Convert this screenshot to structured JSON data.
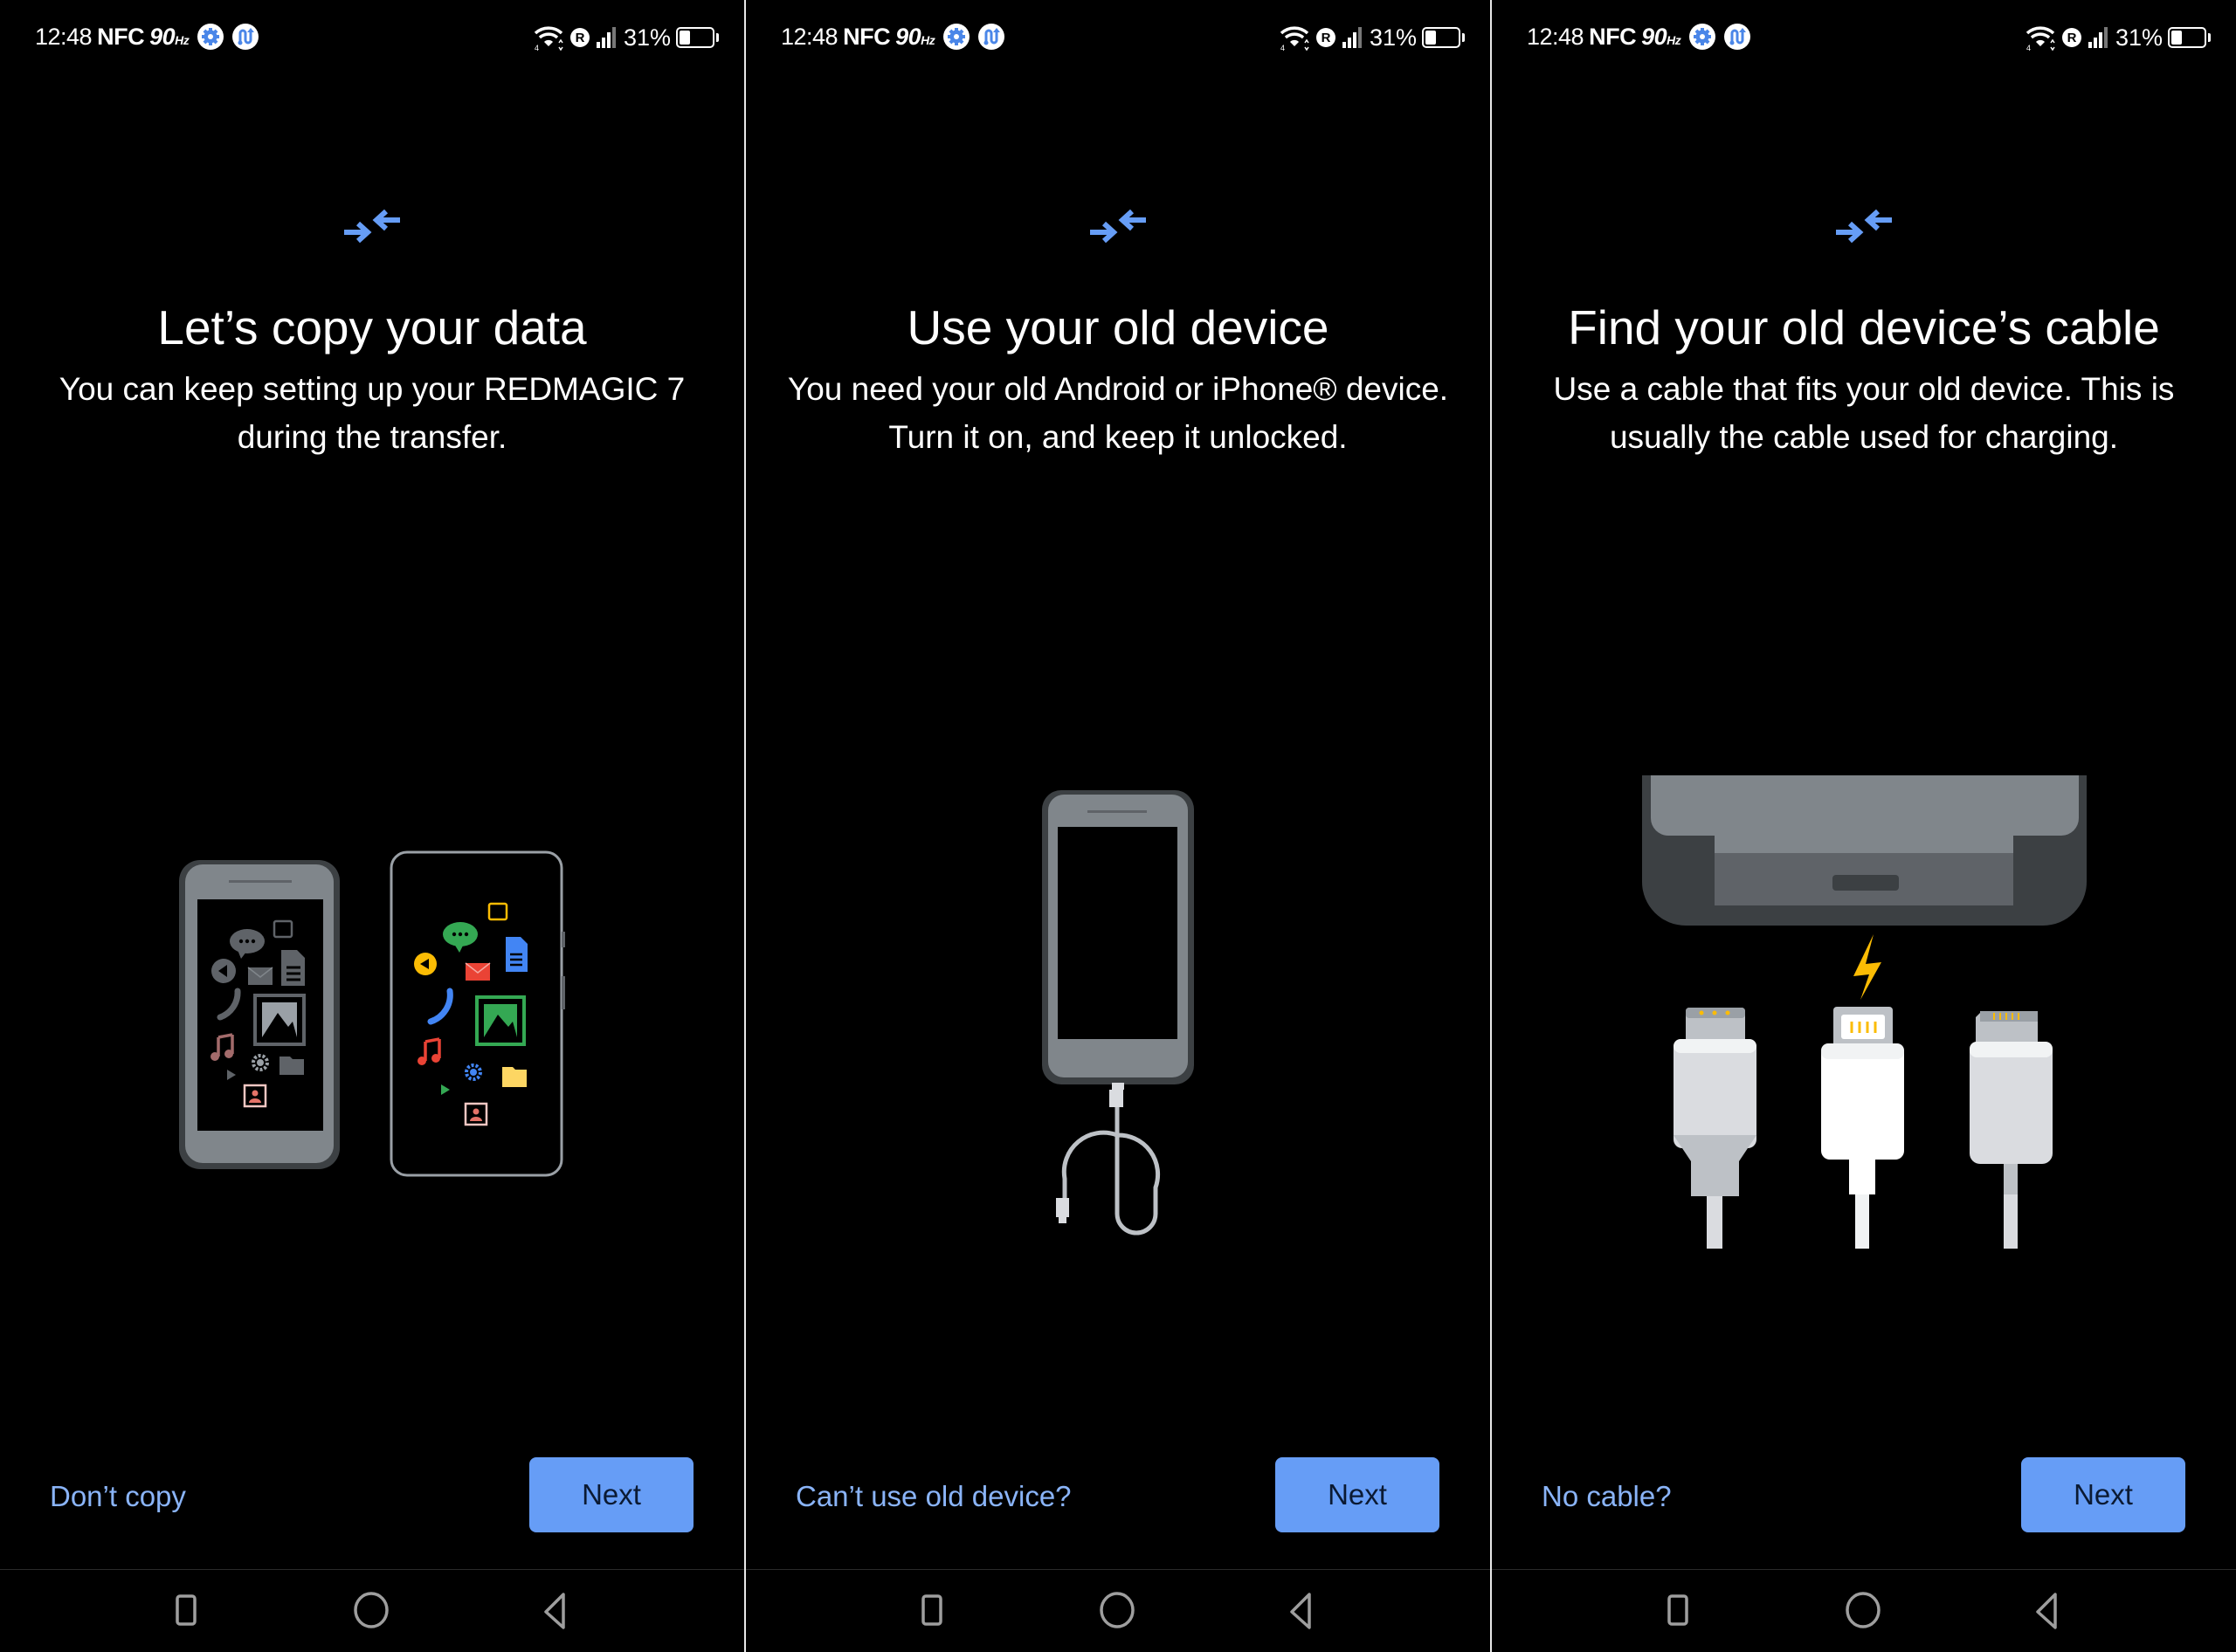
{
  "status_bar": {
    "time": "12:48",
    "nfc": "NFC",
    "refresh_rate": "90",
    "refresh_unit": "Hz",
    "battery_percent": "31%",
    "battery_level": 0.31,
    "icons_left": [
      "settings-gear-icon",
      "data-transfer-icon"
    ],
    "icons_right": [
      "wifi-4-icon",
      "roaming-r-icon",
      "signal-bars-icon",
      "battery-icon"
    ]
  },
  "colors": {
    "accent": "#669df6",
    "link": "#8ab4f8",
    "background": "#000000",
    "illustration_gray": "#80868b",
    "illustration_dark": "#3c4043",
    "bolt": "#fbbc04"
  },
  "screens": [
    {
      "icon": "transfer-arrows-icon",
      "title": "Let’s copy your data",
      "body": "You can keep setting up your REDMAGIC 7 during the transfer.",
      "secondary_action": "Don’t copy",
      "primary_action": "Next",
      "illustration": "two-phones-with-app-icons"
    },
    {
      "icon": "transfer-arrows-icon",
      "title": "Use your old device",
      "body": "You need your old Android or iPhone® device. Turn it on, and keep it unlocked.",
      "secondary_action": "Can’t use old device?",
      "primary_action": "Next",
      "illustration": "old-phone-with-cable"
    },
    {
      "icon": "transfer-arrows-icon",
      "title": "Find your old device’s cable",
      "body": "Use a cable that fits your old device. This is usually the cable used for charging.",
      "secondary_action": "No cable?",
      "primary_action": "Next",
      "illustration": "phone-port-with-three-cables"
    }
  ],
  "nav_bar": {
    "buttons": [
      "recents-square-icon",
      "home-circle-icon",
      "back-triangle-icon"
    ]
  }
}
